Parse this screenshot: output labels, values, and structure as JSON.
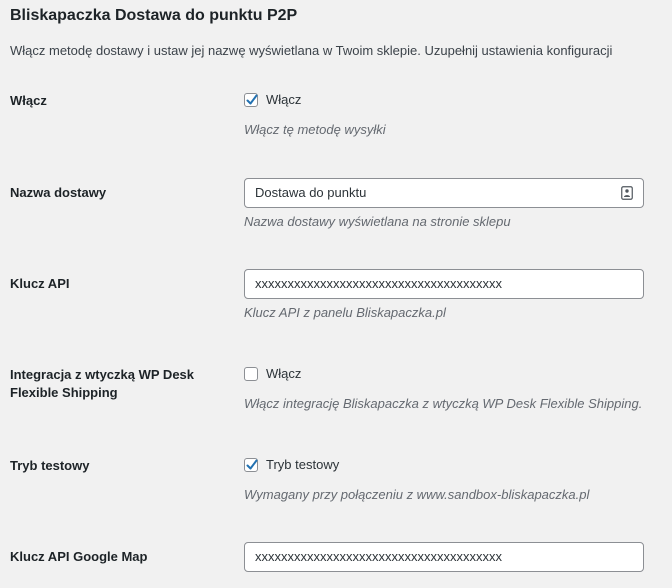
{
  "title": "Bliskapaczka Dostawa do punktu P2P",
  "description": "Włącz metodę dostawy i ustaw jej nazwę wyświetlana w Twoim sklepie. Uzupełnij ustawienia konfiguracji",
  "fields": {
    "enable": {
      "label": "Włącz",
      "checkbox_label": "Włącz",
      "checked": true,
      "help": "Włącz tę metodę wysyłki"
    },
    "shipping_name": {
      "label": "Nazwa dostawy",
      "value": "Dostawa do punktu",
      "help": "Nazwa dostawy wyświetlana na stronie sklepu"
    },
    "api_key": {
      "label": "Klucz API",
      "value": "xxxxxxxxxxxxxxxxxxxxxxxxxxxxxxxxxxxxxx",
      "help": "Klucz API z panelu Bliskapaczka.pl"
    },
    "flexible_shipping": {
      "label_line1": "Integracja z wtyczką WP Desk",
      "label_line2": "Flexible Shipping",
      "checkbox_label": "Włącz",
      "checked": false,
      "help": "Włącz integrację Bliskapaczka z wtyczką WP Desk Flexible Shipping."
    },
    "test_mode": {
      "label": "Tryb testowy",
      "checkbox_label": "Tryb testowy",
      "checked": true,
      "help": "Wymagany przy połączeniu z www.sandbox-bliskapaczka.pl"
    },
    "google_map_key": {
      "label": "Klucz API Google Map",
      "value": "xxxxxxxxxxxxxxxxxxxxxxxxxxxxxxxxxxxxxx"
    }
  },
  "colors": {
    "checkmark": "#2271b1",
    "background": "#f1f1f1"
  },
  "icons": {
    "contact_card": "contact-card-icon"
  }
}
